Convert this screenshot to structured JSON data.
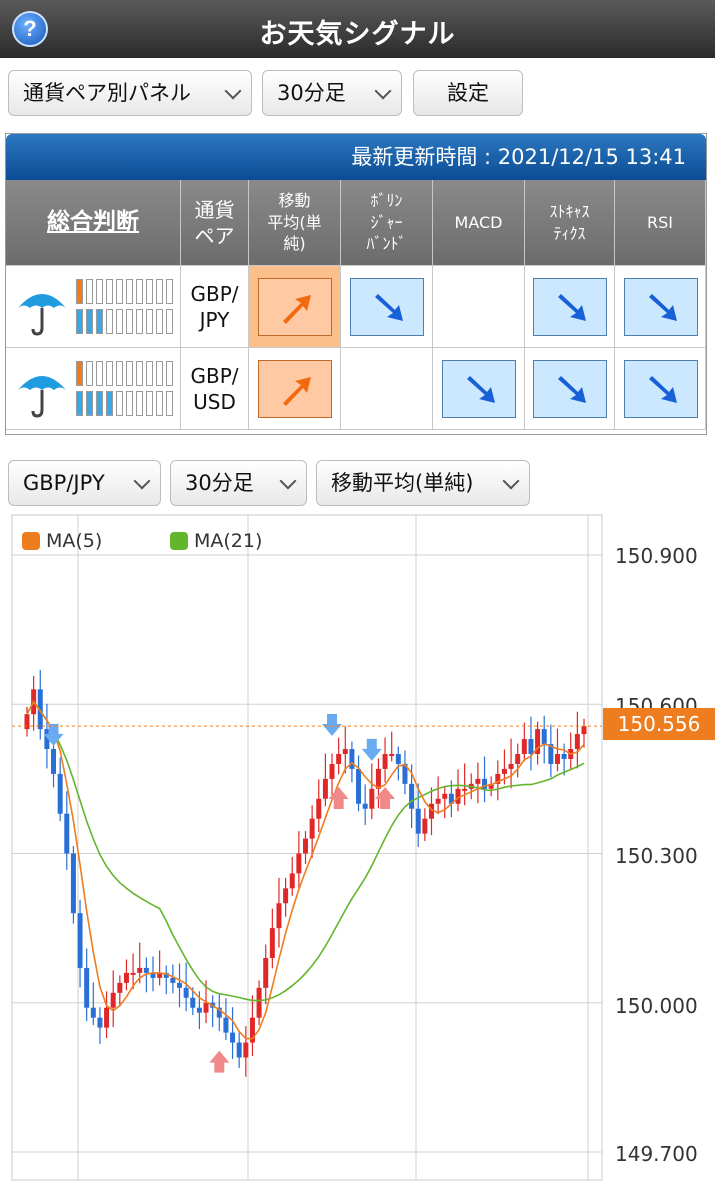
{
  "header": {
    "help_label": "?",
    "title": "お天気シグナル"
  },
  "controls": {
    "panel_select": "通貨ペア別パネル",
    "timeframe_select": "30分足",
    "settings_label": "設定"
  },
  "panel": {
    "update_text": "最新更新時間 : 2021/12/15 13:41",
    "headers": {
      "overall": "総合判断",
      "pair": "通貨\nペア",
      "ma": "移動\n平均(単\n純)",
      "bollinger": "ﾎﾞﾘﾝ\nｼﾞｬｰ\nﾊﾞﾝﾄﾞ",
      "macd": "MACD",
      "stochastics": "ｽﾄｷｬｽ\nﾃｨｸｽ",
      "rsi": "RSI"
    },
    "rows": [
      {
        "pair": "GBP/\nJPY",
        "weather_icon": "umbrella-icon",
        "bars": {
          "orange": 1,
          "blue": 3,
          "total": 10
        },
        "signals": {
          "ma": "up",
          "bollinger": "down",
          "macd": "none",
          "stochastics": "down",
          "rsi": "down"
        }
      },
      {
        "pair": "GBP/\nUSD",
        "weather_icon": "umbrella-icon",
        "bars": {
          "orange": 1,
          "blue": 4,
          "total": 10
        },
        "signals": {
          "ma": "up",
          "bollinger": "none",
          "macd": "down",
          "stochastics": "down",
          "rsi": "down"
        }
      }
    ]
  },
  "chart_controls": {
    "pair_select": "GBP/JPY",
    "timeframe_select": "30分足",
    "indicator_select": "移動平均(単純)"
  },
  "colors": {
    "up_candle": "#e02828",
    "down_candle": "#2a6fd6",
    "ma5": "#ee7d1f",
    "ma21": "#63b52c",
    "buy_arrow": "#f08a8a",
    "sell_arrow": "#6aaaf0",
    "last_price_bg": "#ee7d1f"
  },
  "chart_data": {
    "type": "candlestick",
    "series_names": [
      "MA(5)",
      "MA(21)"
    ],
    "y_ticks": [
      "150.900",
      "150.600",
      "150.300",
      "150.000",
      "149.700"
    ],
    "ylim": [
      149.7,
      150.9
    ],
    "last_price": "150.556",
    "closes": [
      150.58,
      150.63,
      150.55,
      150.51,
      150.46,
      150.38,
      150.3,
      150.18,
      150.07,
      149.99,
      149.97,
      149.95,
      149.99,
      150.02,
      150.04,
      150.06,
      150.06,
      150.07,
      150.06,
      150.05,
      150.06,
      150.05,
      150.04,
      150.03,
      150.01,
      149.99,
      149.98,
      150.0,
      149.99,
      149.97,
      149.94,
      149.92,
      149.89,
      149.92,
      149.97,
      150.03,
      150.09,
      150.15,
      150.2,
      150.23,
      150.26,
      150.3,
      150.33,
      150.37,
      150.41,
      150.45,
      150.48,
      150.5,
      150.51,
      150.47,
      150.4,
      150.39,
      150.43,
      150.47,
      150.5,
      150.5,
      150.48,
      150.44,
      150.39,
      150.34,
      150.37,
      150.4,
      150.41,
      150.42,
      150.4,
      150.43,
      150.43,
      150.44,
      150.45,
      150.43,
      150.44,
      150.46,
      150.47,
      150.48,
      150.5,
      150.53,
      150.5,
      150.55,
      150.52,
      150.48,
      150.5,
      150.49,
      150.51,
      150.54,
      150.556
    ],
    "signals": [
      {
        "type": "sell",
        "index": 4
      },
      {
        "type": "buy",
        "index": 29
      },
      {
        "type": "sell",
        "index": 46
      },
      {
        "type": "buy",
        "index": 47
      },
      {
        "type": "sell",
        "index": 52
      },
      {
        "type": "buy",
        "index": 54
      }
    ]
  }
}
